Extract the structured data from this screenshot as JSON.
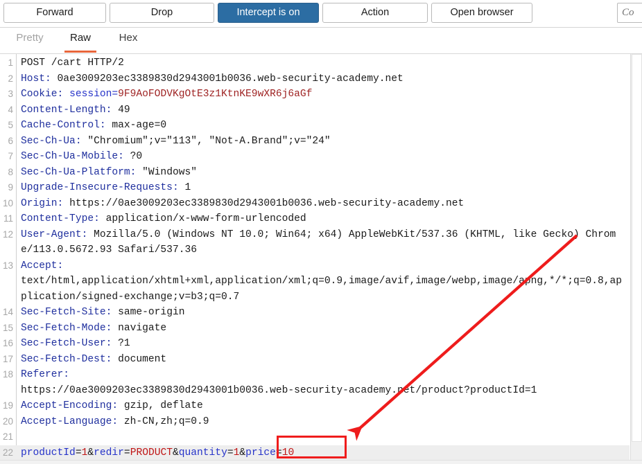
{
  "toolbar": {
    "forward_label": "Forward",
    "drop_label": "Drop",
    "intercept_label": "Intercept is on",
    "action_label": "Action",
    "open_browser_label": "Open browser",
    "intercept_on_color": "#2c6da3",
    "search_placeholder": "Co"
  },
  "view_tabs": {
    "pretty_label": "Pretty",
    "raw_label": "Raw",
    "hex_label": "Hex",
    "active": "Raw",
    "active_underline_color": "#e8663b"
  },
  "editor_icons": {
    "word_wrap_label": "",
    "newline_label": "\\n",
    "menu_label": ""
  },
  "request": {
    "lines": [
      {
        "num": "1",
        "type": "start",
        "text": "POST /cart HTTP/2"
      },
      {
        "num": "2",
        "type": "header",
        "name": "Host:",
        "value": " 0ae3009203ec3389830d2943001b0036.web-security-academy.net"
      },
      {
        "num": "3",
        "type": "cookie",
        "name": "Cookie:",
        "key": " session=",
        "value": "9F9AoFODVKgOtE3z1KtnKE9wXR6j6aGf"
      },
      {
        "num": "4",
        "type": "header",
        "name": "Content-Length:",
        "value": " 49"
      },
      {
        "num": "5",
        "type": "header",
        "name": "Cache-Control:",
        "value": " max-age=0"
      },
      {
        "num": "6",
        "type": "header",
        "name": "Sec-Ch-Ua:",
        "value": " \"Chromium\";v=\"113\", \"Not-A.Brand\";v=\"24\""
      },
      {
        "num": "7",
        "type": "header",
        "name": "Sec-Ch-Ua-Mobile:",
        "value": " ?0"
      },
      {
        "num": "8",
        "type": "header",
        "name": "Sec-Ch-Ua-Platform:",
        "value": " \"Windows\""
      },
      {
        "num": "9",
        "type": "header",
        "name": "Upgrade-Insecure-Requests:",
        "value": " 1"
      },
      {
        "num": "10",
        "type": "header",
        "name": "Origin:",
        "value": " https://0ae3009203ec3389830d2943001b0036.web-security-academy.net"
      },
      {
        "num": "11",
        "type": "header",
        "name": "Content-Type:",
        "value": " application/x-www-form-urlencoded"
      },
      {
        "num": "12",
        "type": "header",
        "name": "User-Agent:",
        "value": " Mozilla/5.0 (Windows NT 10.0; Win64; x64) AppleWebKit/537.36 (KHTML, like Gecko) Chrome/113.0.5672.93 Safari/537.36"
      },
      {
        "num": "13",
        "type": "header",
        "name": "Accept:",
        "value": "\ntext/html,application/xhtml+xml,application/xml;q=0.9,image/avif,image/webp,image/apng,*/*;q=0.8,application/signed-exchange;v=b3;q=0.7"
      },
      {
        "num": "14",
        "type": "header",
        "name": "Sec-Fetch-Site:",
        "value": " same-origin"
      },
      {
        "num": "15",
        "type": "header",
        "name": "Sec-Fetch-Mode:",
        "value": " navigate"
      },
      {
        "num": "16",
        "type": "header",
        "name": "Sec-Fetch-User:",
        "value": " ?1"
      },
      {
        "num": "17",
        "type": "header",
        "name": "Sec-Fetch-Dest:",
        "value": " document"
      },
      {
        "num": "18",
        "type": "header",
        "name": "Referer:",
        "value": "\nhttps://0ae3009203ec3389830d2943001b0036.web-security-academy.net/product?productId=1"
      },
      {
        "num": "19",
        "type": "header",
        "name": "Accept-Encoding:",
        "value": " gzip, deflate"
      },
      {
        "num": "20",
        "type": "header",
        "name": "Accept-Language:",
        "value": " zh-CN,zh;q=0.9"
      },
      {
        "num": "21",
        "type": "blank",
        "text": ""
      },
      {
        "num": "22",
        "type": "body",
        "text": ""
      }
    ],
    "body_params": [
      {
        "key": "productId",
        "sep": "=",
        "value": "1",
        "amp": "&"
      },
      {
        "key": "redir",
        "sep": "=",
        "value": "PRODUCT",
        "amp": "&"
      },
      {
        "key": "quantity",
        "sep": "=",
        "value": "1",
        "amp": "&"
      },
      {
        "key": "price",
        "sep": "=",
        "value": "10",
        "amp": ""
      }
    ]
  },
  "annotation": {
    "highlight_target": "price=10",
    "highlight_color": "#ef1c1c",
    "arrow_color": "#ee1c1c",
    "arrow_from": "830,342",
    "arrow_to": "510,625"
  }
}
